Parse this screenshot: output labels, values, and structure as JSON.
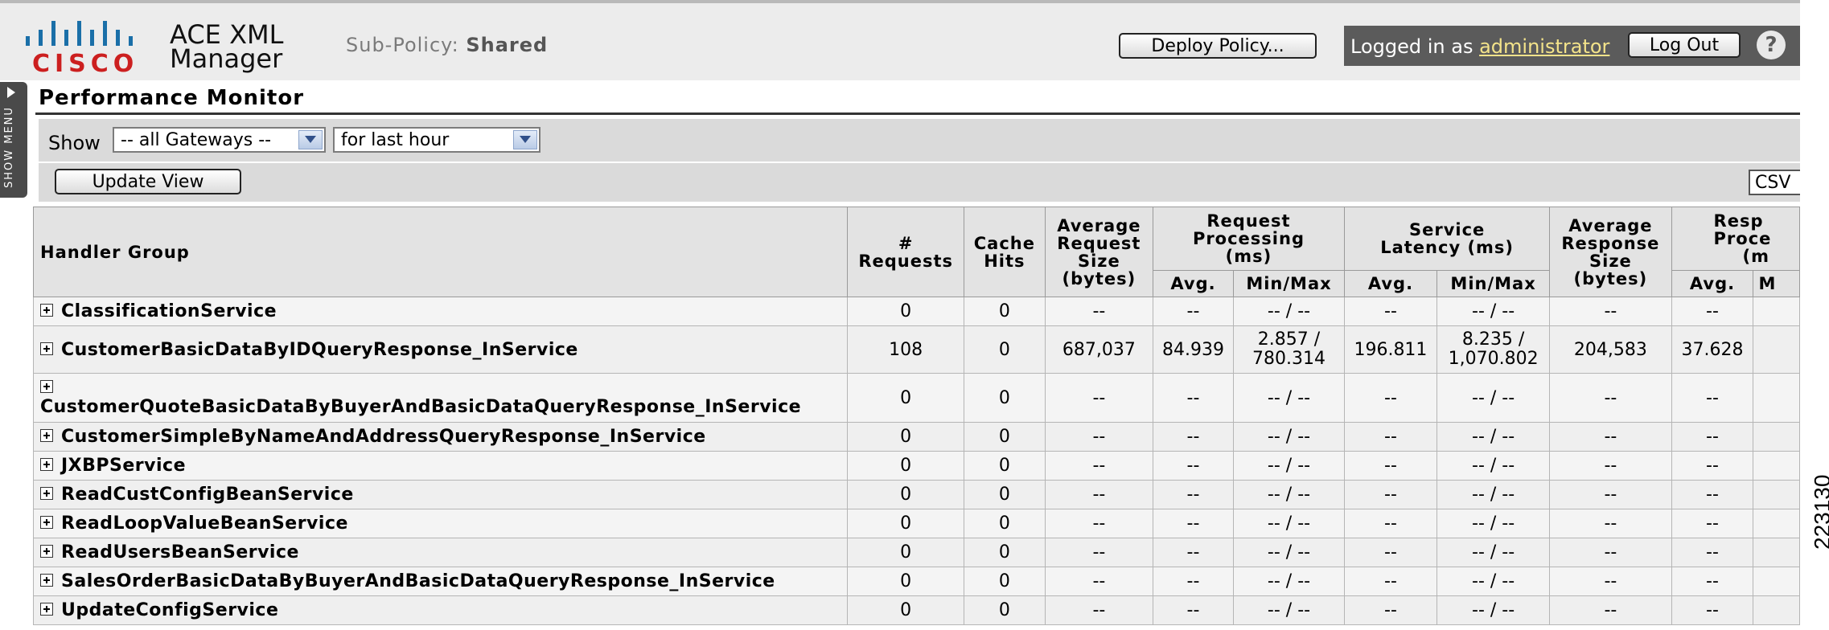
{
  "header": {
    "logo_text": "CISCO",
    "app_title_line1": "ACE XML",
    "app_title_line2": "Manager",
    "subpolicy_label": "Sub-Policy:",
    "subpolicy_value": "Shared",
    "deploy_label": "Deploy Policy...",
    "logged_in_prefix": "Logged in as",
    "username": "administrator",
    "logout_label": "Log Out",
    "help_icon": "?"
  },
  "side_menu": {
    "label": "SHOW MENU"
  },
  "page": {
    "title": "Performance Monitor"
  },
  "filters": {
    "show_label": "Show",
    "gateway_value": "-- all Gateways --",
    "time_value": "for last hour",
    "update_label": "Update View",
    "csv_label": "CSV"
  },
  "table": {
    "headers": {
      "handler_group": "Handler Group",
      "requests": [
        "#",
        "Requests"
      ],
      "cache_hits": [
        "Cache",
        "Hits"
      ],
      "avg_request_size": [
        "Average",
        "Request",
        "Size",
        "(bytes)"
      ],
      "request_processing": [
        "Request",
        "Processing",
        "(ms)"
      ],
      "service_latency": [
        "Service",
        "Latency (ms)"
      ],
      "avg_response_size": [
        "Average",
        "Response",
        "Size",
        "(bytes)"
      ],
      "response_processing": [
        "Resp",
        "Proce",
        "(m"
      ],
      "avg": "Avg.",
      "minmax": "Min/Max",
      "cut": "M"
    },
    "rows": [
      {
        "name": "ClassificationService",
        "requests": "0",
        "cache": "0",
        "req_size": "--",
        "rp_avg": "--",
        "rp_minmax": [
          "-- / --"
        ],
        "sl_avg": "--",
        "sl_minmax": [
          "-- / --"
        ],
        "resp_size": "--",
        "resp_avg": "--"
      },
      {
        "name": "CustomerBasicDataByIDQueryResponse_InService",
        "requests": "108",
        "cache": "0",
        "req_size": "687,037",
        "rp_avg": "84.939",
        "rp_minmax": [
          "2.857 /",
          "780.314"
        ],
        "sl_avg": "196.811",
        "sl_minmax": [
          "8.235 /",
          "1,070.802"
        ],
        "resp_size": "204,583",
        "resp_avg": "37.628"
      },
      {
        "name": "CustomerQuoteBasicDataByBuyerAndBasicDataQueryResponse_InService",
        "requests": "0",
        "cache": "0",
        "req_size": "--",
        "rp_avg": "--",
        "rp_minmax": [
          "-- / --"
        ],
        "sl_avg": "--",
        "sl_minmax": [
          "-- / --"
        ],
        "resp_size": "--",
        "resp_avg": "--"
      },
      {
        "name": "CustomerSimpleByNameAndAddressQueryResponse_InService",
        "requests": "0",
        "cache": "0",
        "req_size": "--",
        "rp_avg": "--",
        "rp_minmax": [
          "-- / --"
        ],
        "sl_avg": "--",
        "sl_minmax": [
          "-- / --"
        ],
        "resp_size": "--",
        "resp_avg": "--"
      },
      {
        "name": "JXBPService",
        "requests": "0",
        "cache": "0",
        "req_size": "--",
        "rp_avg": "--",
        "rp_minmax": [
          "-- / --"
        ],
        "sl_avg": "--",
        "sl_minmax": [
          "-- / --"
        ],
        "resp_size": "--",
        "resp_avg": "--"
      },
      {
        "name": "ReadCustConfigBeanService",
        "requests": "0",
        "cache": "0",
        "req_size": "--",
        "rp_avg": "--",
        "rp_minmax": [
          "-- / --"
        ],
        "sl_avg": "--",
        "sl_minmax": [
          "-- / --"
        ],
        "resp_size": "--",
        "resp_avg": "--"
      },
      {
        "name": "ReadLoopValueBeanService",
        "requests": "0",
        "cache": "0",
        "req_size": "--",
        "rp_avg": "--",
        "rp_minmax": [
          "-- / --"
        ],
        "sl_avg": "--",
        "sl_minmax": [
          "-- / --"
        ],
        "resp_size": "--",
        "resp_avg": "--"
      },
      {
        "name": "ReadUsersBeanService",
        "requests": "0",
        "cache": "0",
        "req_size": "--",
        "rp_avg": "--",
        "rp_minmax": [
          "-- / --"
        ],
        "sl_avg": "--",
        "sl_minmax": [
          "-- / --"
        ],
        "resp_size": "--",
        "resp_avg": "--"
      },
      {
        "name": "SalesOrderBasicDataByBuyerAndBasicDataQueryResponse_InService",
        "requests": "0",
        "cache": "0",
        "req_size": "--",
        "rp_avg": "--",
        "rp_minmax": [
          "-- / --"
        ],
        "sl_avg": "--",
        "sl_minmax": [
          "-- / --"
        ],
        "resp_size": "--",
        "resp_avg": "--"
      },
      {
        "name": "UpdateConfigService",
        "requests": "0",
        "cache": "0",
        "req_size": "--",
        "rp_avg": "--",
        "rp_minmax": [
          "-- / --"
        ],
        "sl_avg": "--",
        "sl_minmax": [
          "-- / --"
        ],
        "resp_size": "--",
        "resp_avg": "--"
      }
    ]
  },
  "figure_id": "223130",
  "colors": {
    "header_bg": "#ececec",
    "login_panel": "#5b5b5b",
    "username": "#f3e38a",
    "cisco_red": "#cc1f1f",
    "cisco_blue": "#1a6fa8"
  }
}
